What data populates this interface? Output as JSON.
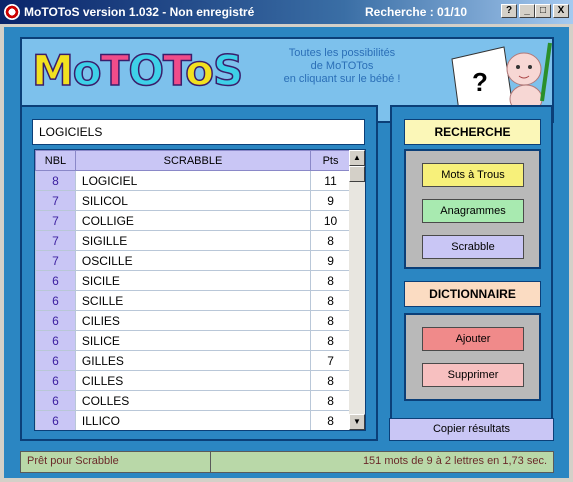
{
  "window": {
    "title": "MoTOToS version 1.032 - Non enregistré",
    "search_counter": "Recherche : 01/10",
    "buttons": {
      "help": "?",
      "minimize": "_",
      "maximize": "□",
      "close": "X"
    }
  },
  "header": {
    "logo": [
      "M",
      "o",
      "T",
      "O",
      "T",
      "o",
      "S"
    ],
    "logo_colors": [
      "#f2e11f",
      "#3ed0e8",
      "#f04c8a",
      "#3ed0e8",
      "#f04c8a",
      "#f2e11f",
      "#3ed0e8"
    ],
    "tagline": [
      "Toutes les possibilités",
      "de MoTOTos",
      "en cliquant sur le bébé !"
    ],
    "sign": "?"
  },
  "search": {
    "value": "LOGICIELS"
  },
  "grid": {
    "columns": [
      "NBL",
      "SCRABBLE",
      "Pts"
    ],
    "rows": [
      {
        "nbl": "8",
        "word": "LOGICIEL",
        "pts": "11"
      },
      {
        "nbl": "7",
        "word": "SILICOL",
        "pts": "9"
      },
      {
        "nbl": "7",
        "word": "COLLIGE",
        "pts": "10"
      },
      {
        "nbl": "7",
        "word": "SIGILLE",
        "pts": "8"
      },
      {
        "nbl": "7",
        "word": "OSCILLE",
        "pts": "9"
      },
      {
        "nbl": "6",
        "word": "SICILE",
        "pts": "8"
      },
      {
        "nbl": "6",
        "word": "SCILLE",
        "pts": "8"
      },
      {
        "nbl": "6",
        "word": "CILIES",
        "pts": "8"
      },
      {
        "nbl": "6",
        "word": "SILICE",
        "pts": "8"
      },
      {
        "nbl": "6",
        "word": "GILLES",
        "pts": "7"
      },
      {
        "nbl": "6",
        "word": "CILLES",
        "pts": "8"
      },
      {
        "nbl": "6",
        "word": "COLLES",
        "pts": "8"
      },
      {
        "nbl": "6",
        "word": "ILLICO",
        "pts": "8"
      }
    ]
  },
  "recherche": {
    "title": "RECHERCHE",
    "buttons": [
      {
        "label": "Mots à Trous",
        "color": "#f7f07a"
      },
      {
        "label": "Anagrammes",
        "color": "#a8eab0"
      },
      {
        "label": "Scrabble",
        "color": "#c9c6f5"
      }
    ]
  },
  "dictionnaire": {
    "title": "DICTIONNAIRE",
    "buttons": [
      {
        "label": "Ajouter",
        "color": "#f08a8a"
      },
      {
        "label": "Supprimer",
        "color": "#f7c0c0"
      }
    ]
  },
  "copy_label": "Copier résultats",
  "status": {
    "left": "Prêt pour Scrabble",
    "right": "151 mots de 9 à 2 lettres en 1,73 sec."
  }
}
